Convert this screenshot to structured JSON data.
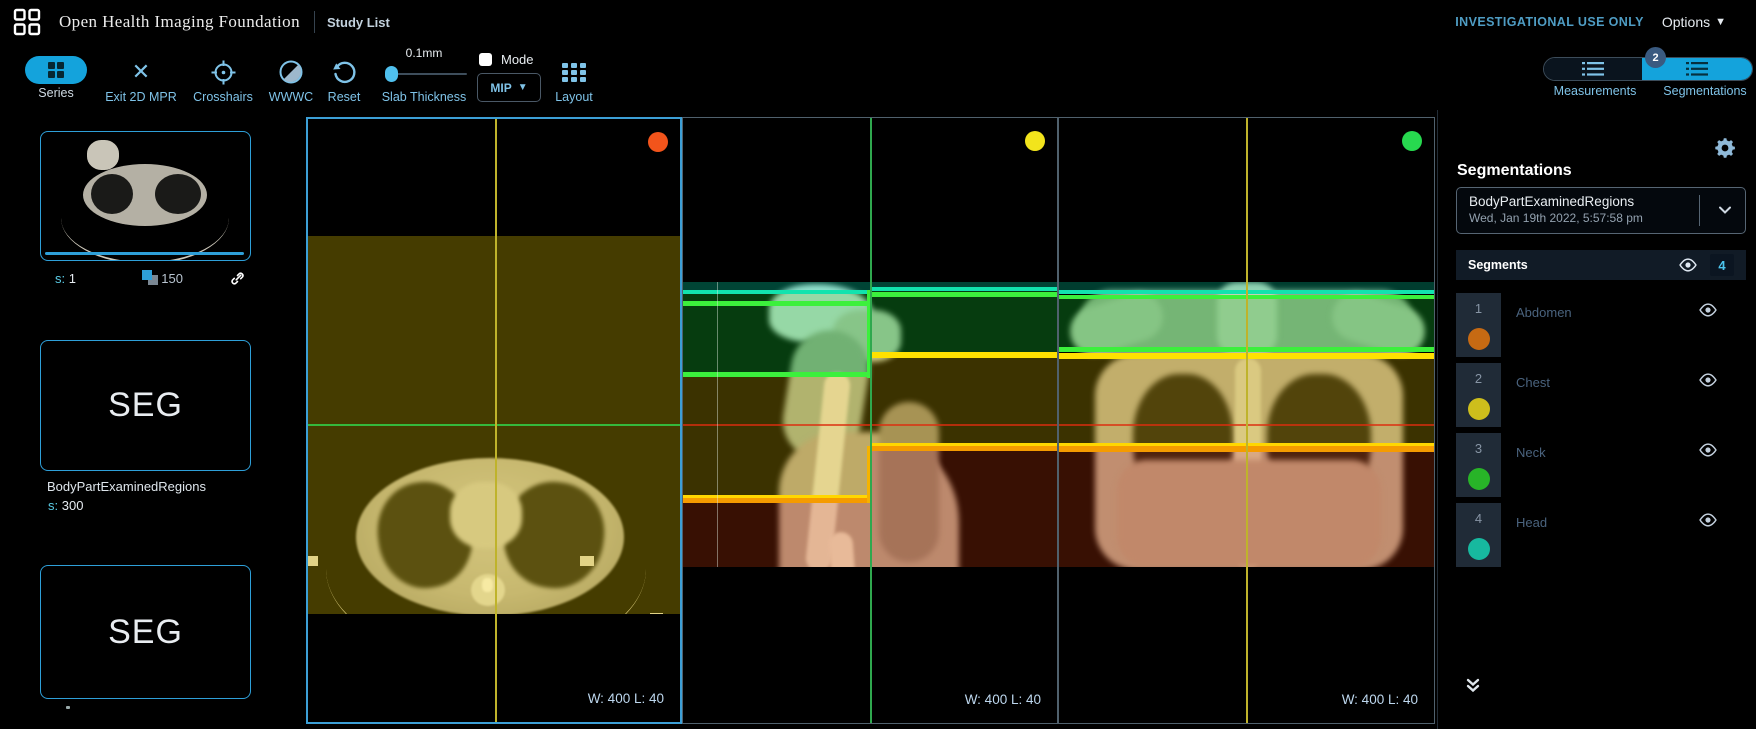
{
  "topbar": {
    "app_title": "Open Health Imaging Foundation",
    "nav_study_list": "Study List",
    "investigational": "INVESTIGATIONAL USE ONLY",
    "options_label": "Options"
  },
  "toolbar": {
    "series_label": "Series",
    "exit_mpr_label": "Exit 2D MPR",
    "crosshairs_label": "Crosshairs",
    "wwwc_label": "WWWC",
    "reset_label": "Reset",
    "slab": {
      "value": "0.1mm",
      "label": "Slab Thickness"
    },
    "mode": {
      "label": "Mode",
      "dropdown_value": "MIP"
    },
    "layout_label": "Layout",
    "panel_toggles": {
      "measurements": "Measurements",
      "segmentations": "Segmentations",
      "badge": "2"
    }
  },
  "sidebar": {
    "thumbnails": [
      {
        "type": "image",
        "series_prefix": "s:",
        "series_number": "1",
        "instance_count": "150"
      },
      {
        "type": "seg",
        "modality": "SEG",
        "description": "BodyPartExaminedRegions",
        "series_prefix": "s:",
        "series_number": "300"
      },
      {
        "type": "seg",
        "modality": "SEG"
      }
    ]
  },
  "viewports": [
    {
      "orientation": "axial",
      "dot_color": "#f2541b",
      "window_level": "W: 400 L: 40"
    },
    {
      "orientation": "sagittal",
      "dot_color": "#f2e41c",
      "window_level": "W: 400 L: 40"
    },
    {
      "orientation": "coronal",
      "dot_color": "#27d94f",
      "window_level": "W: 400 L: 40"
    }
  ],
  "segmentations_panel": {
    "title": "Segmentations",
    "active_segmentation": {
      "name": "BodyPartExaminedRegions",
      "date": "Wed, Jan 19th 2022, 5:57:58 pm"
    },
    "segments_header": {
      "label": "Segments",
      "count": "4"
    },
    "segments": [
      {
        "index": "1",
        "label": "Abdomen",
        "color": "#c66a13"
      },
      {
        "index": "2",
        "label": "Chest",
        "color": "#cdbe1c"
      },
      {
        "index": "3",
        "label": "Neck",
        "color": "#28b428"
      },
      {
        "index": "4",
        "label": "Head",
        "color": "#17b99f"
      }
    ]
  },
  "accent_color": "#14a3dc"
}
